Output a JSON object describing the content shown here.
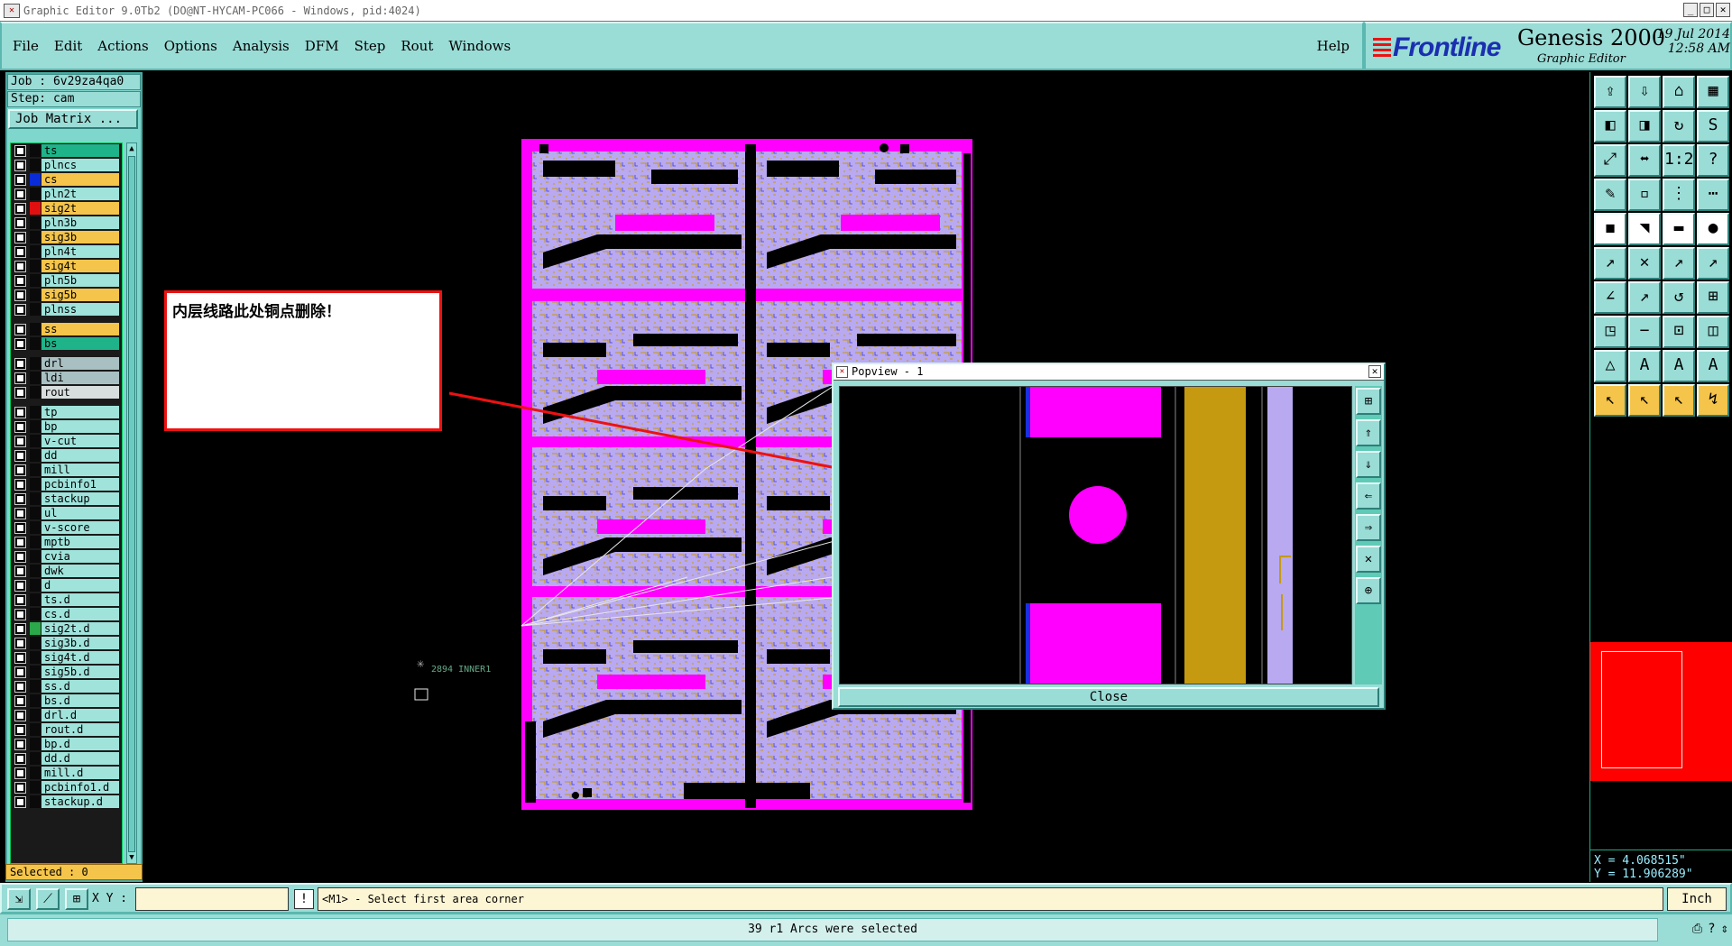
{
  "window": {
    "title": "Graphic Editor 9.0Tb2 (DO@NT-HYCAM-PC066 - Windows, pid:4024)"
  },
  "menu": {
    "items": [
      "File",
      "Edit",
      "Actions",
      "Options",
      "Analysis",
      "DFM",
      "Step",
      "Rout",
      "Windows"
    ],
    "help": "Help"
  },
  "brand": {
    "logo": "Frontline",
    "product": "Genesis 2000",
    "subtitle": "Graphic Editor",
    "date": "19 Jul 2014",
    "time": "12:58 AM"
  },
  "job": {
    "job_line": "Job : 6v29za4qa0",
    "step_line": "Step: cam",
    "matrix_button": "Job Matrix ..."
  },
  "layers": [
    {
      "name": "ts",
      "color": "#1fb389",
      "swatch": "#0a0a0a"
    },
    {
      "name": "plncs",
      "color": "#9fe3db",
      "swatch": "#0a0a0a"
    },
    {
      "name": "cs",
      "color": "#f5c44a",
      "swatch": "#0a2bd8"
    },
    {
      "name": "pln2t",
      "color": "#9fe3db",
      "swatch": "#0a0a0a"
    },
    {
      "name": "sig2t",
      "color": "#f5c44a",
      "swatch": "#e01010"
    },
    {
      "name": "pln3b",
      "color": "#9fe3db",
      "swatch": "#0a0a0a"
    },
    {
      "name": "sig3b",
      "color": "#f5c44a",
      "swatch": "#0a0a0a"
    },
    {
      "name": "pln4t",
      "color": "#9fe3db",
      "swatch": "#0a0a0a"
    },
    {
      "name": "sig4t",
      "color": "#f5c44a",
      "swatch": "#0a0a0a"
    },
    {
      "name": "pln5b",
      "color": "#9fe3db",
      "swatch": "#0a0a0a"
    },
    {
      "name": "sig5b",
      "color": "#f5c44a",
      "swatch": "#0a0a0a"
    },
    {
      "name": "plnss",
      "color": "#9fe3db",
      "swatch": "#0a0a0a"
    },
    {
      "name": "ss",
      "color": "#f5c44a",
      "swatch": "#0a0a0a"
    },
    {
      "name": "bs",
      "color": "#1fb389",
      "swatch": "#0a0a0a"
    },
    {
      "name": "drl",
      "color": "#a9c0c2",
      "swatch": "#0a0a0a"
    },
    {
      "name": "ldi",
      "color": "#a9c0c2",
      "swatch": "#0a0a0a"
    },
    {
      "name": "rout",
      "color": "#d8dede",
      "swatch": "#0a0a0a"
    },
    {
      "name": "tp",
      "color": "#9fe3db",
      "swatch": "#0a0a0a"
    },
    {
      "name": "bp",
      "color": "#9fe3db",
      "swatch": "#0a0a0a"
    },
    {
      "name": "v-cut",
      "color": "#9fe3db",
      "swatch": "#0a0a0a"
    },
    {
      "name": "dd",
      "color": "#9fe3db",
      "swatch": "#0a0a0a"
    },
    {
      "name": "mill",
      "color": "#9fe3db",
      "swatch": "#0a0a0a"
    },
    {
      "name": "pcbinfo1",
      "color": "#9fe3db",
      "swatch": "#0a0a0a"
    },
    {
      "name": "stackup",
      "color": "#9fe3db",
      "swatch": "#0a0a0a"
    },
    {
      "name": "ul",
      "color": "#9fe3db",
      "swatch": "#0a0a0a"
    },
    {
      "name": "v-score",
      "color": "#9fe3db",
      "swatch": "#0a0a0a"
    },
    {
      "name": "mptb",
      "color": "#9fe3db",
      "swatch": "#0a0a0a"
    },
    {
      "name": "cvia",
      "color": "#9fe3db",
      "swatch": "#0a0a0a"
    },
    {
      "name": "dwk",
      "color": "#9fe3db",
      "swatch": "#0a0a0a"
    },
    {
      "name": "d",
      "color": "#9fe3db",
      "swatch": "#0a0a0a"
    },
    {
      "name": "ts.d",
      "color": "#9fe3db",
      "swatch": "#0a0a0a"
    },
    {
      "name": "cs.d",
      "color": "#9fe3db",
      "swatch": "#0a0a0a"
    },
    {
      "name": "sig2t.d",
      "color": "#9fe3db",
      "swatch": "#2aa84a"
    },
    {
      "name": "sig3b.d",
      "color": "#9fe3db",
      "swatch": "#0a0a0a"
    },
    {
      "name": "sig4t.d",
      "color": "#9fe3db",
      "swatch": "#0a0a0a"
    },
    {
      "name": "sig5b.d",
      "color": "#9fe3db",
      "swatch": "#0a0a0a"
    },
    {
      "name": "ss.d",
      "color": "#9fe3db",
      "swatch": "#0a0a0a"
    },
    {
      "name": "bs.d",
      "color": "#9fe3db",
      "swatch": "#0a0a0a"
    },
    {
      "name": "drl.d",
      "color": "#9fe3db",
      "swatch": "#0a0a0a"
    },
    {
      "name": "rout.d",
      "color": "#9fe3db",
      "swatch": "#0a0a0a"
    },
    {
      "name": "bp.d",
      "color": "#9fe3db",
      "swatch": "#0a0a0a"
    },
    {
      "name": "dd.d",
      "color": "#9fe3db",
      "swatch": "#0a0a0a"
    },
    {
      "name": "mill.d",
      "color": "#9fe3db",
      "swatch": "#0a0a0a"
    },
    {
      "name": "pcbinfo1.d",
      "color": "#9fe3db",
      "swatch": "#0a0a0a"
    },
    {
      "name": "stackup.d",
      "color": "#9fe3db",
      "swatch": "#0a0a0a"
    }
  ],
  "selected": "Selected : 0",
  "board": {
    "label": "2894  INNER1",
    "colors": {
      "copper": "#ff00ff",
      "laminate": "#b9a9f0",
      "trace": "#c59a10",
      "void": "#000000"
    }
  },
  "note": {
    "text": "内层线路此处铜点删除！"
  },
  "popview": {
    "title": "Popview - 1",
    "close_label": "Close",
    "tools": [
      "⊞",
      "⇑",
      "⇓",
      "⇐",
      "⇒",
      "✕",
      "⊕"
    ]
  },
  "toolbox": {
    "icons": [
      "⇪",
      "⇩",
      "⌂",
      "▦",
      "◧",
      "◨",
      "↻",
      "S",
      "⤢",
      "⬌",
      "1:2",
      "?",
      "✎",
      "▫",
      "⋮",
      "⋯",
      "◼",
      "◥",
      "▬",
      "●",
      "↗",
      "✕",
      "↗",
      "↗",
      "∠",
      "↗",
      "↺",
      "⊞",
      "◳",
      "−",
      "⊡",
      "◫",
      "△",
      "A",
      "A",
      "A",
      "↖",
      "↖",
      "↖",
      "↯"
    ]
  },
  "coords": {
    "x": "X = 4.068515\"",
    "y": "Y = 11.906289\""
  },
  "cmdbar": {
    "xy_label": "X Y :",
    "xy_value": "",
    "excl": "!",
    "prompt": "<M1> - Select first area corner",
    "units": "Inch"
  },
  "status": {
    "message": "39 r1 Arcs were selected"
  }
}
